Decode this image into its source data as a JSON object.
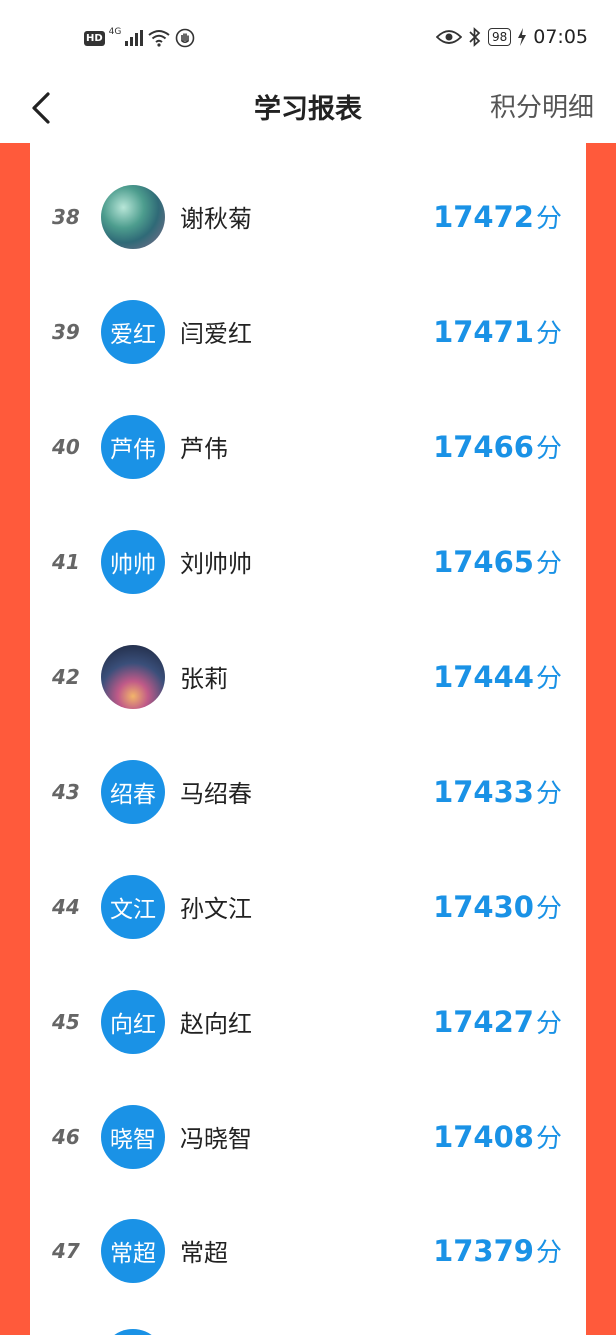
{
  "status_bar": {
    "hd": "HD",
    "network": "4G",
    "battery": "98",
    "time": "07:05"
  },
  "nav": {
    "title": "学习报表",
    "right_link": "积分明细"
  },
  "colors": {
    "accent": "#1a92e6",
    "side_band": "#ff5a3b"
  },
  "rows": [
    {
      "rank": "38",
      "avatar_text": "",
      "avatar_type": "photo",
      "name": "谢秋菊",
      "score": "17472",
      "unit": "分"
    },
    {
      "rank": "39",
      "avatar_text": "爱红",
      "avatar_type": "text",
      "name": "闫爱红",
      "score": "17471",
      "unit": "分"
    },
    {
      "rank": "40",
      "avatar_text": "芦伟",
      "avatar_type": "text",
      "name": "芦伟",
      "score": "17466",
      "unit": "分"
    },
    {
      "rank": "41",
      "avatar_text": "帅帅",
      "avatar_type": "text",
      "name": "刘帅帅",
      "score": "17465",
      "unit": "分"
    },
    {
      "rank": "42",
      "avatar_text": "",
      "avatar_type": "photo",
      "name": "张莉",
      "score": "17444",
      "unit": "分"
    },
    {
      "rank": "43",
      "avatar_text": "绍春",
      "avatar_type": "text",
      "name": "马绍春",
      "score": "17433",
      "unit": "分"
    },
    {
      "rank": "44",
      "avatar_text": "文江",
      "avatar_type": "text",
      "name": "孙文江",
      "score": "17430",
      "unit": "分"
    },
    {
      "rank": "45",
      "avatar_text": "向红",
      "avatar_type": "text",
      "name": "赵向红",
      "score": "17427",
      "unit": "分"
    },
    {
      "rank": "46",
      "avatar_text": "晓智",
      "avatar_type": "text",
      "name": "冯晓智",
      "score": "17408",
      "unit": "分"
    },
    {
      "rank": "47",
      "avatar_text": "常超",
      "avatar_type": "text",
      "name": "常超",
      "score": "17379",
      "unit": "分"
    }
  ]
}
